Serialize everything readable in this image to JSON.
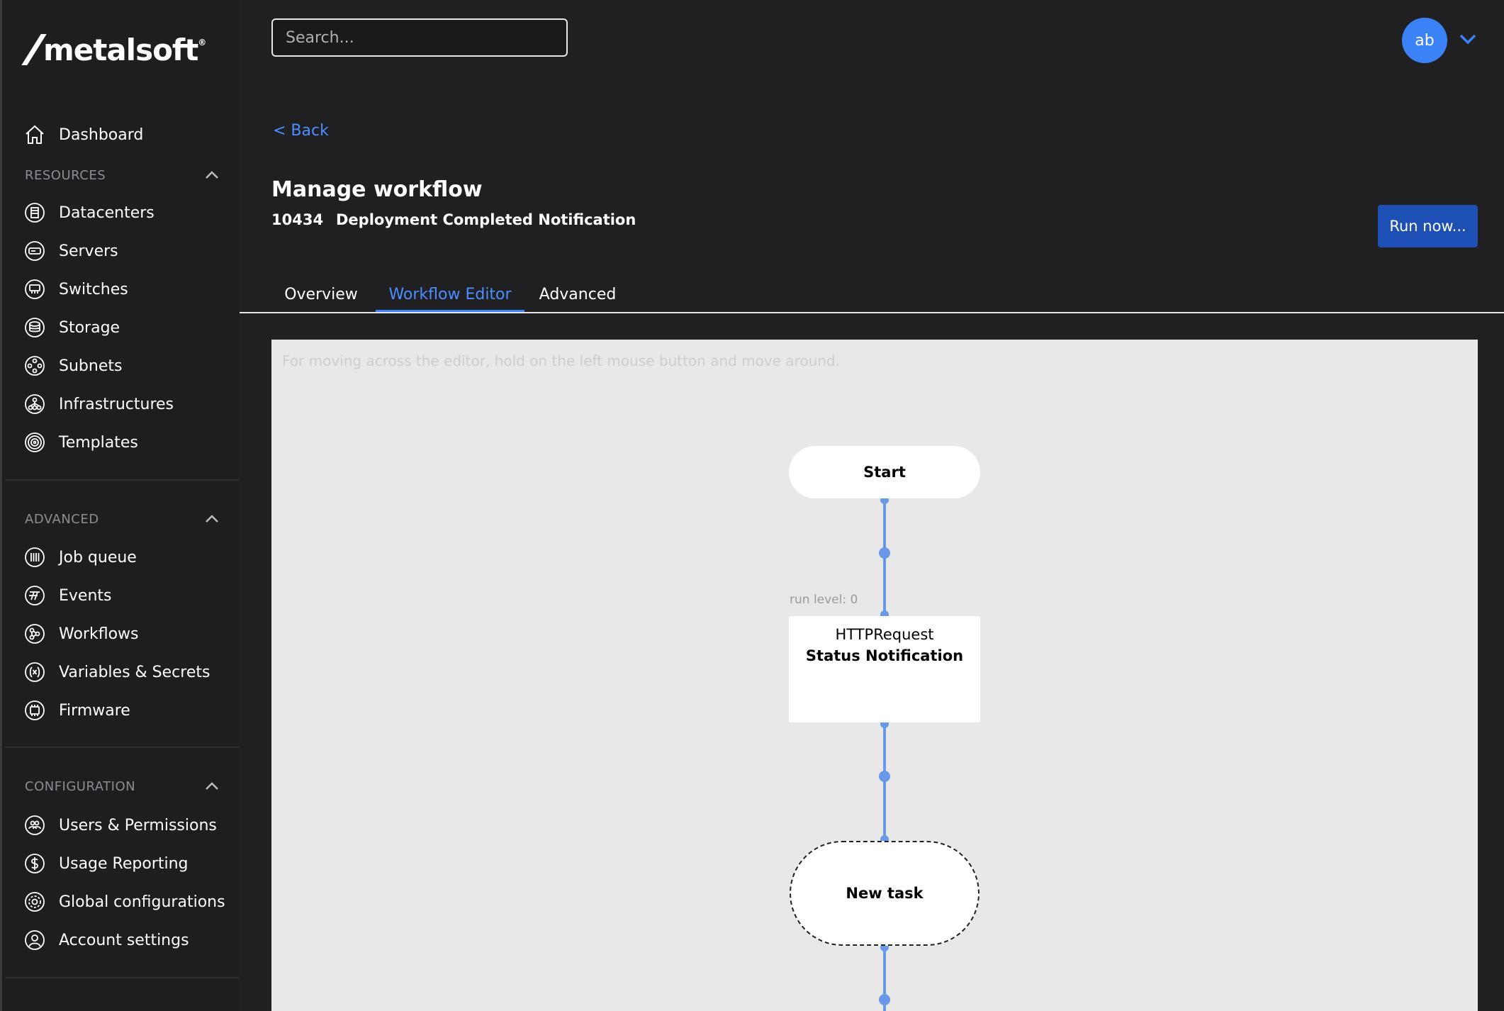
{
  "brand": {
    "name": "metalsoft",
    "reg": "®"
  },
  "search": {
    "placeholder": "Search..."
  },
  "user": {
    "initials": "ab"
  },
  "sidebar": {
    "dashboard": "Dashboard",
    "resources": {
      "header": "RESOURCES",
      "items": [
        "Datacenters",
        "Servers",
        "Switches",
        "Storage",
        "Subnets",
        "Infrastructures",
        "Templates"
      ]
    },
    "advanced": {
      "header": "ADVANCED",
      "items": [
        "Job queue",
        "Events",
        "Workflows",
        "Variables & Secrets",
        "Firmware"
      ]
    },
    "configuration": {
      "header": "CONFIGURATION",
      "items": [
        "Users & Permissions",
        "Usage Reporting",
        "Global configurations",
        "Account settings"
      ]
    }
  },
  "page": {
    "back": "< Back",
    "title": "Manage workflow",
    "workflow_id": "10434",
    "workflow_name": "Deployment Completed Notification",
    "run_button": "Run now..."
  },
  "tabs": [
    "Overview",
    "Workflow Editor",
    "Advanced"
  ],
  "active_tab": "Workflow Editor",
  "editor": {
    "hint": "For moving across the editor, hold on the left mouse button and move around.",
    "start_label": "Start",
    "run_level": "run level: 0",
    "task_type": "HTTPRequest",
    "task_name": "Status Notification",
    "new_task": "New task"
  },
  "colors": {
    "accent": "#3b82f6",
    "link": "#4a8eff",
    "button": "#1e4fb4",
    "connector": "#6a98e8",
    "canvas": "#e8e8e8"
  }
}
